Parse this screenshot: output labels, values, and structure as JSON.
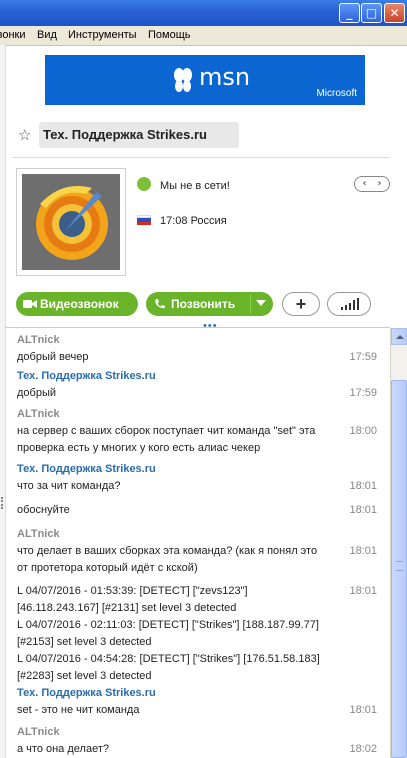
{
  "menu": [
    "Звонки",
    "Вид",
    "Инструменты",
    "Помощь"
  ],
  "banner": {
    "logo_text": "msn",
    "brand": "Microsoft"
  },
  "contact": {
    "name": "Тех. Поддержка Strikes.ru",
    "status": "Мы не в сети!",
    "local_time": "17:08 Россия"
  },
  "actions": {
    "video": "Видеозвонок",
    "call": "Позвонить",
    "add": "+"
  },
  "messages": [
    {
      "sender": "ALTnick",
      "sender_type": "user",
      "text": "добрый вечер",
      "time": "17:59"
    },
    {
      "sender": "Тех. Поддержка Strikes.ru",
      "sender_type": "support",
      "text": "добрый",
      "time": "17:59"
    },
    {
      "sender": "ALTnick",
      "sender_type": "user",
      "text": "на сервер с ваших сборок поступает чит команда \"set\" эта проверка есть у многих у кого есть алиас чекер",
      "time": "18:00"
    },
    {
      "sender": "Тех. Поддержка Strikes.ru",
      "sender_type": "support",
      "text": "что за чит команда?",
      "time": "18:01"
    },
    {
      "sender": "",
      "sender_type": "support",
      "text": "обоснуйте",
      "time": "18:01"
    },
    {
      "sender": "ALTnick",
      "sender_type": "user",
      "text": "что делает в ваших сборках эта команда? (как я понял это от протетора который идёт с кской)",
      "time": "18:01"
    },
    {
      "sender": "",
      "sender_type": "user",
      "text": "L 04/07/2016 - 01:53:39: [DETECT] [\"zevs123\"] [46.118.243.167] [#2131] set level 3 detected\nL 04/07/2016 - 02:11:03: [DETECT] [\"Strikes\"] [188.187.99.77] [#2153] set level 3 detected\nL 04/07/2016 - 04:54:28: [DETECT] [\"Strikes\"] [176.51.58.183] [#2283] set level 3 detected",
      "time": "18:01"
    },
    {
      "sender": "Тех. Поддержка Strikes.ru",
      "sender_type": "support",
      "text": "set - это не чит команда",
      "time": "18:01"
    },
    {
      "sender": "ALTnick",
      "sender_type": "user",
      "text": "а что она делает?",
      "time": "18:02"
    }
  ]
}
